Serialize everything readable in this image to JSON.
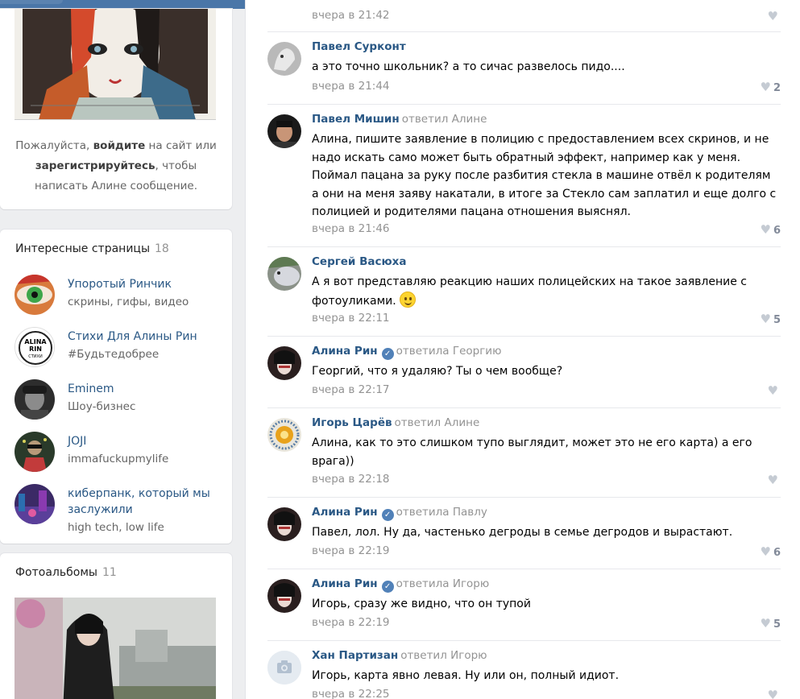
{
  "profile": {
    "login_prefix": "Пожалуйста, ",
    "login_link": "войдите",
    "login_middle": " на сайт или",
    "register_link": "зарегистрируйтесь",
    "login_suffix": ", чтобы",
    "login_line3": "написать Алине сообщение."
  },
  "pages": {
    "title": "Интересные страницы",
    "count": "18",
    "items": [
      {
        "name": "Упоротый Ринчик",
        "desc": "скрины, гифы, видео"
      },
      {
        "name": "Стихи Для Алины Рин",
        "desc": "#Будьтедобрее",
        "logo_line1": "ALINA",
        "logo_line2": "RIN",
        "logo_line3": "СТИХИ"
      },
      {
        "name": "Eminem",
        "desc": "Шоу-бизнес"
      },
      {
        "name": "JOJI",
        "desc": "immafuckupmylife"
      },
      {
        "name": "киберпанк, который мы заслужили",
        "desc": "high tech, low life"
      }
    ]
  },
  "albums": {
    "title": "Фотоальбомы",
    "count": "11"
  },
  "comments": [
    {
      "author": "",
      "reply": "",
      "text": "",
      "time": "вчера в 21:42",
      "likes": ""
    },
    {
      "author": "Павел Сурконт",
      "reply": "",
      "text": "а это точно школьник? а то сичас развелось пидо....",
      "time": "вчера в 21:44",
      "likes": "2"
    },
    {
      "author": "Павел Мишин",
      "reply": "ответил Алине",
      "text": "Алина, пишите заявление в полицию с предоставлением всех скринов, и не надо искать само может быть обратный эффект, например как у меня. Поймал пацана за руку после разбития стекла в машине отвёл к родителям а они на меня заяву накатали, в итоге за Стекло сам заплатил и еще долго с полицией и родителями пацана отношения выяснял.",
      "time": "вчера в 21:46",
      "likes": "6"
    },
    {
      "author": "Сергей Васюха",
      "reply": "",
      "text": "А я вот представляю реакцию наших полицейских на такое заявление с фотоуликами.",
      "time": "вчера в 22:11",
      "likes": "5"
    },
    {
      "author": "Алина Рин",
      "reply": "ответила Георгию",
      "text": "Георгий, что я удаляю? Ты о чем вообще?",
      "time": "вчера в 22:17",
      "likes": ""
    },
    {
      "author": "Игорь Царёв",
      "reply": "ответил Алине",
      "text": "Алина, как то это слишком тупо выглядит, может это не его карта) а его врага))",
      "time": "вчера в 22:18",
      "likes": ""
    },
    {
      "author": "Алина Рин",
      "reply": "ответила Павлу",
      "text": "Павел, лол. Ну да, частенько дегроды в семье дегродов и вырастают.",
      "time": "вчера в 22:19",
      "likes": "6"
    },
    {
      "author": "Алина Рин",
      "reply": "ответила Игорю",
      "text": "Игорь, сразу же видно, что он тупой",
      "time": "вчера в 22:19",
      "likes": "5"
    },
    {
      "author": "Хан Партизан",
      "reply": "ответил Игорю",
      "text": "Игорь, карта явно левая. Ну или он, полный идиот.",
      "time": "вчера в 22:25",
      "likes": ""
    }
  ],
  "icons": {
    "heart": "heart-icon",
    "verified": "verified-icon",
    "camera": "camera-icon"
  },
  "colors": {
    "accent": "#4a76a8",
    "link": "#2a5885",
    "muted": "#939393"
  }
}
